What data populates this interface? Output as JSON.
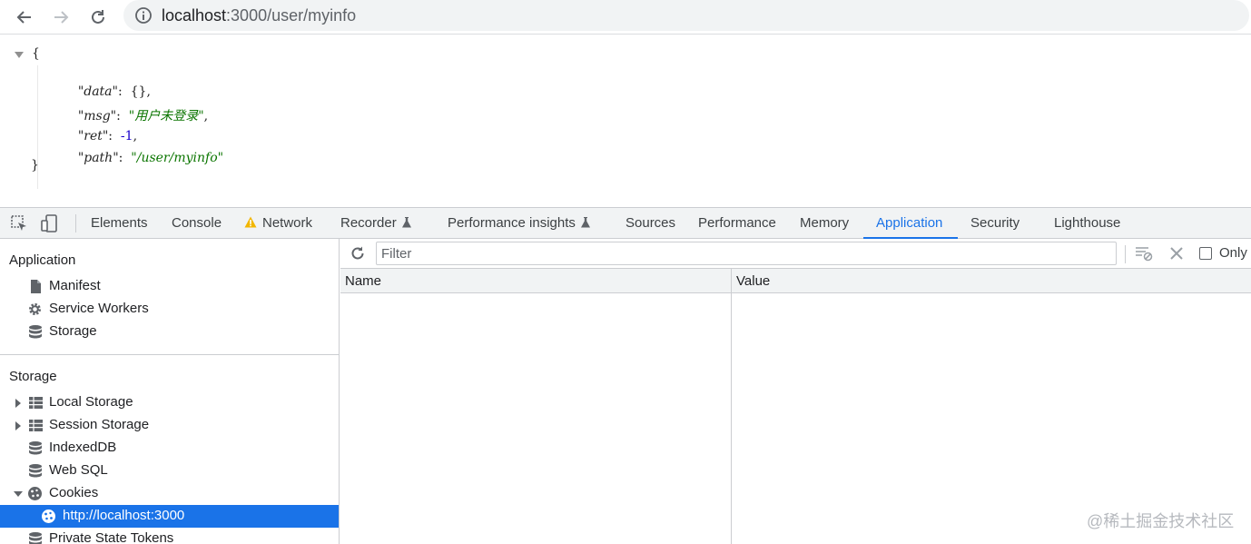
{
  "browser": {
    "url_host": "localhost",
    "url_path": ":3000/user/myinfo",
    "back_icon": "arrow-left-icon",
    "forward_icon": "arrow-right-icon",
    "reload_icon": "reload-icon",
    "info_icon": "info-icon"
  },
  "json_view": {
    "open_brace": "{",
    "close_brace": "}",
    "entries": [
      {
        "key": "\"data\"",
        "sep": ":  ",
        "value": "{}",
        "type": "obj",
        "comma": ","
      },
      {
        "key": "\"msg\"",
        "sep": ":  ",
        "value": "\"用户未登录\"",
        "type": "str",
        "comma": ","
      },
      {
        "key": "\"ret\"",
        "sep": ":  ",
        "value": "-1",
        "type": "num",
        "comma": ","
      },
      {
        "key": "\"path\"",
        "sep": ":  ",
        "value": "\"/user/myinfo\"",
        "type": "str",
        "comma": ""
      }
    ]
  },
  "devtools": {
    "tabs": [
      "Elements",
      "Console",
      "Network",
      "Recorder",
      "Performance insights",
      "Sources",
      "Performance",
      "Memory",
      "Application",
      "Security",
      "Lighthouse"
    ],
    "active_tab": "Application",
    "sidebar": {
      "application_title": "Application",
      "application_items": [
        "Manifest",
        "Service Workers",
        "Storage"
      ],
      "storage_title": "Storage",
      "storage_items": [
        "Local Storage",
        "Session Storage",
        "IndexedDB",
        "Web SQL",
        "Cookies",
        "http://localhost:3000",
        "Private State Tokens"
      ]
    },
    "main": {
      "filter_placeholder": "Filter",
      "only_label": "Only",
      "columns": [
        "Name",
        "Value"
      ]
    }
  },
  "watermark": "@稀土掘金技术社区",
  "colors": {
    "accent": "#1a73e8",
    "json_string": "#0b7500",
    "json_number": "#1a01cc",
    "warning": "#f2b600"
  }
}
